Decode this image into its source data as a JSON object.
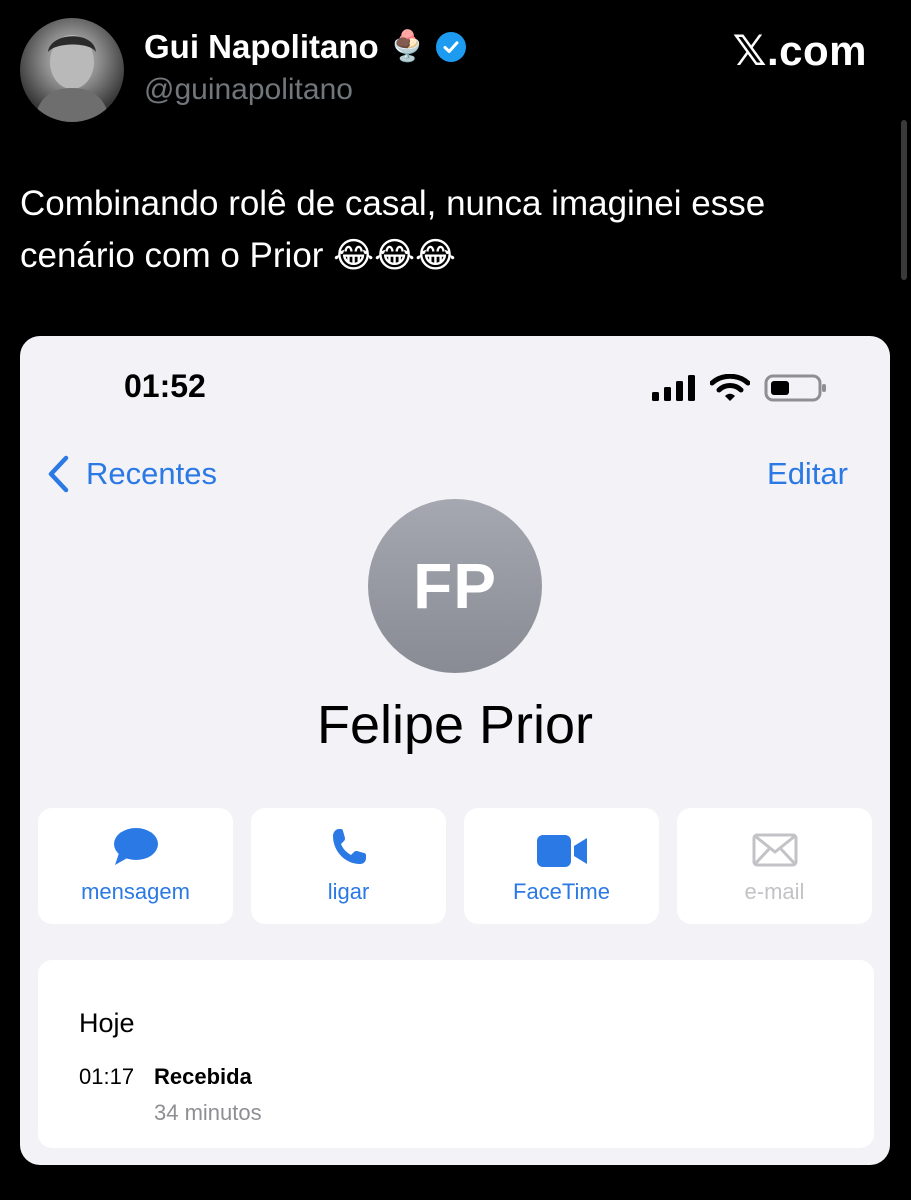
{
  "tweet": {
    "author_name": "Gui Napolitano",
    "author_emoji": "🍨",
    "handle": "@guinapolitano",
    "site": "𝕏.com",
    "text": "Combinando rolê de casal, nunca imaginei esse cenário com o Prior 😂😂😂"
  },
  "phone": {
    "status_time": "01:52",
    "nav": {
      "back_label": "Recentes",
      "edit_label": "Editar"
    },
    "contact": {
      "initials": "FP",
      "name": "Felipe Prior"
    },
    "actions": [
      {
        "label": "mensagem",
        "icon": "message-icon",
        "enabled": true
      },
      {
        "label": "ligar",
        "icon": "phone-icon",
        "enabled": true
      },
      {
        "label": "FaceTime",
        "icon": "video-icon",
        "enabled": true
      },
      {
        "label": "e-mail",
        "icon": "mail-icon",
        "enabled": false
      }
    ],
    "history": {
      "day": "Hoje",
      "time": "01:17",
      "type": "Recebida",
      "duration": "34 minutos"
    }
  },
  "colors": {
    "background": "#000000",
    "accent_blue": "#2b79e4",
    "verified_blue": "#1d9bf0",
    "card_bg": "#f2f2f7"
  }
}
